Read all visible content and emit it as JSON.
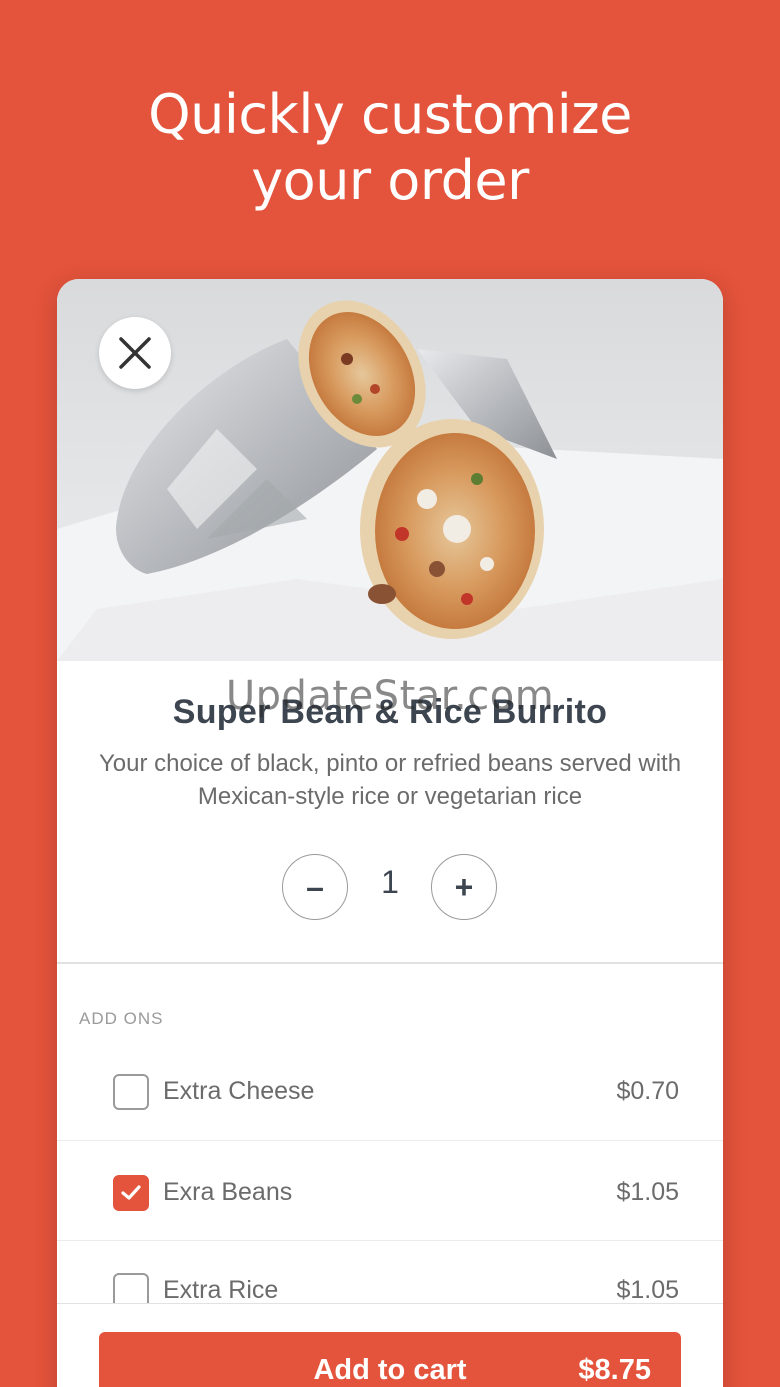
{
  "headline": {
    "line1": "Quickly customize",
    "line2": "your order"
  },
  "hero": {
    "image_description_icon": "burrito-photo",
    "close_icon": "close-icon"
  },
  "watermark": "UpdateStar.com",
  "product": {
    "title": "Super Bean & Rice Burrito",
    "description": "Your choice of black, pinto or refried beans served with Mexican-style rice or vegetarian rice"
  },
  "quantity": {
    "minus_label": "–",
    "value": "1",
    "plus_label": "+"
  },
  "addons": {
    "section_label": "ADD ONS",
    "items": [
      {
        "name": "Extra Cheese",
        "price": "$0.70",
        "checked": false
      },
      {
        "name": "Exra Beans",
        "price": "$1.05",
        "checked": true
      },
      {
        "name": "Extra Rice",
        "price": "$1.05",
        "checked": false
      }
    ]
  },
  "cart": {
    "label": "Add to cart",
    "price": "$8.75"
  },
  "colors": {
    "brand": "#e4533b",
    "text_dark": "#3d4650",
    "text_muted": "#6b6b6b"
  }
}
